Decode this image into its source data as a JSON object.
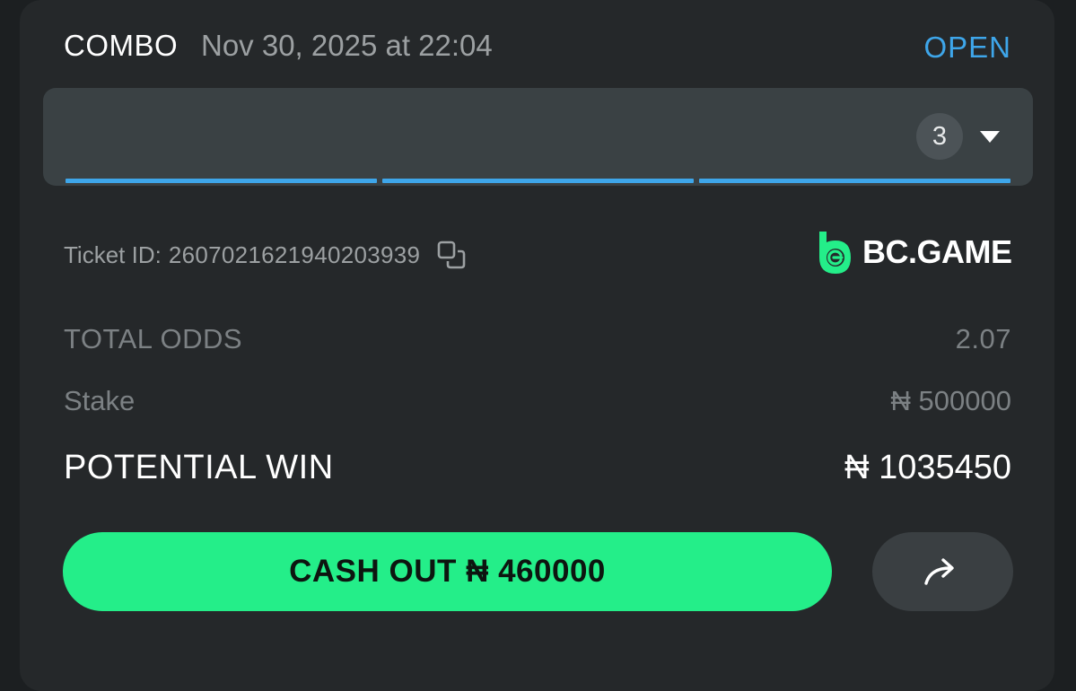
{
  "bet": {
    "type": "COMBO",
    "date": "Nov 30, 2025 at 22:04",
    "status": "OPEN"
  },
  "selections": {
    "count": "3",
    "toggle_icon": "caret-down-icon"
  },
  "ticket": {
    "label": "Ticket ID:",
    "id": "2607021621940203939",
    "copy_icon": "copy-icon"
  },
  "brand": {
    "name": "BC.GAME",
    "color": "#24ee89"
  },
  "summary": {
    "total_odds_label": "TOTAL ODDS",
    "total_odds_value": "2.07",
    "stake_label": "Stake",
    "stake_value": "₦ 500000",
    "potential_win_label": "POTENTIAL WIN",
    "potential_win_value": "₦ 1035450"
  },
  "actions": {
    "cashout_label": "CASH OUT ₦ 460000",
    "share_icon": "share-arrow-icon"
  },
  "colors": {
    "accent_blue": "#3ea6ea",
    "accent_green": "#24ee89",
    "card_bg": "#25282a"
  }
}
